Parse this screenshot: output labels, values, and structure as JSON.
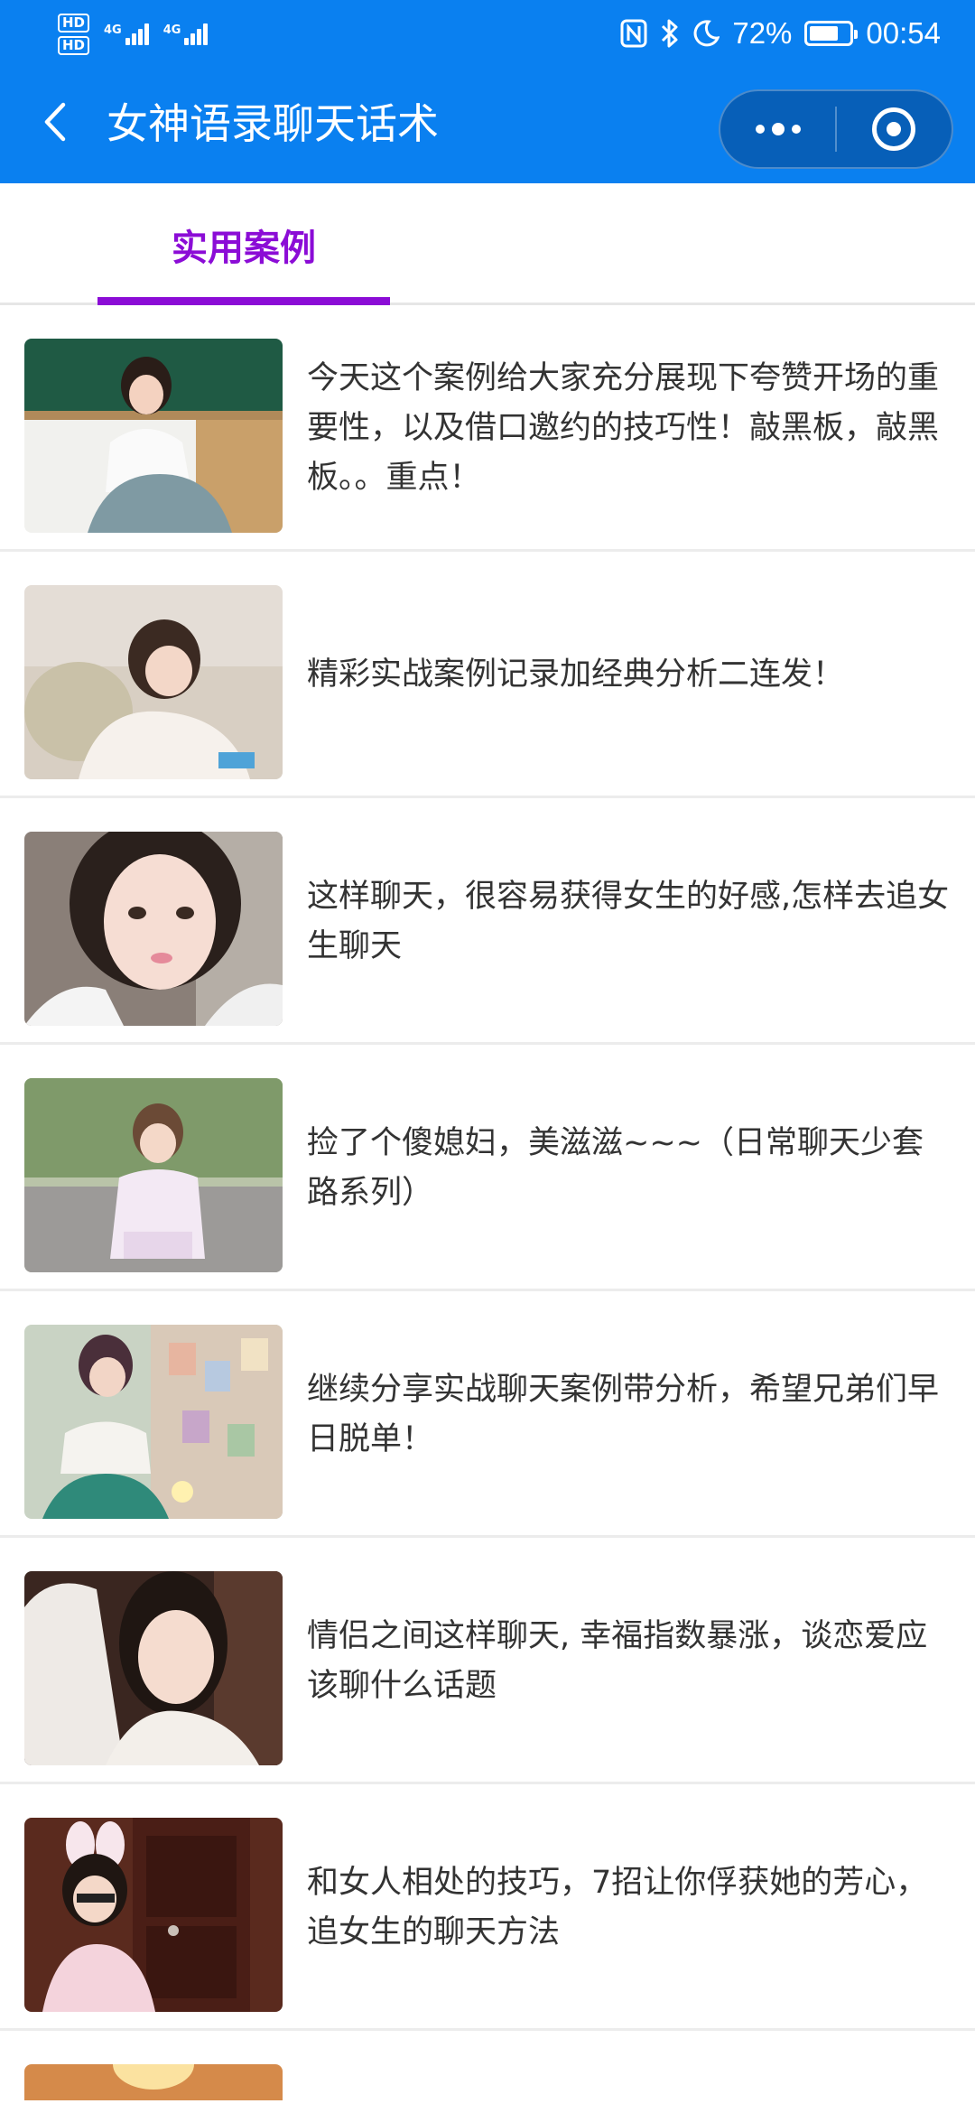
{
  "status_bar": {
    "hd1": "HD",
    "hd2": "HD",
    "net1": "4G",
    "net2": "4G",
    "battery": "72%",
    "battery_level": 0.72,
    "time": "00:54"
  },
  "nav": {
    "title": "女神语录聊天话术",
    "back_icon": "chevron-left-icon",
    "more_icon": "more-dots-icon",
    "close_icon": "target-circle-icon"
  },
  "tabs": [
    {
      "label": "实用案例",
      "active": true
    }
  ],
  "colors": {
    "header_bg": "#0a80f0",
    "tab_accent": "#8b0cd6",
    "text": "#333333"
  },
  "articles": [
    {
      "title": "今天这个案例给大家充分展现下夸赞开场的重要性，以及借口邀约的技巧性！敲黑板，敲黑板。。重点！"
    },
    {
      "title": "精彩实战案例记录加经典分析二连发！"
    },
    {
      "title": "这样聊天，很容易获得女生的好感,怎样去追女生聊天"
    },
    {
      "title": "捡了个傻媳妇，美滋滋~~~（日常聊天少套路系列）"
    },
    {
      "title": "继续分享实战聊天案例带分析，希望兄弟们早日脱单！"
    },
    {
      "title": "情侣之间这样聊天, 幸福指数暴涨，谈恋爱应该聊什么话题"
    },
    {
      "title": "和女人相处的技巧，7招让你俘获她的芳心，追女生的聊天方法"
    }
  ]
}
